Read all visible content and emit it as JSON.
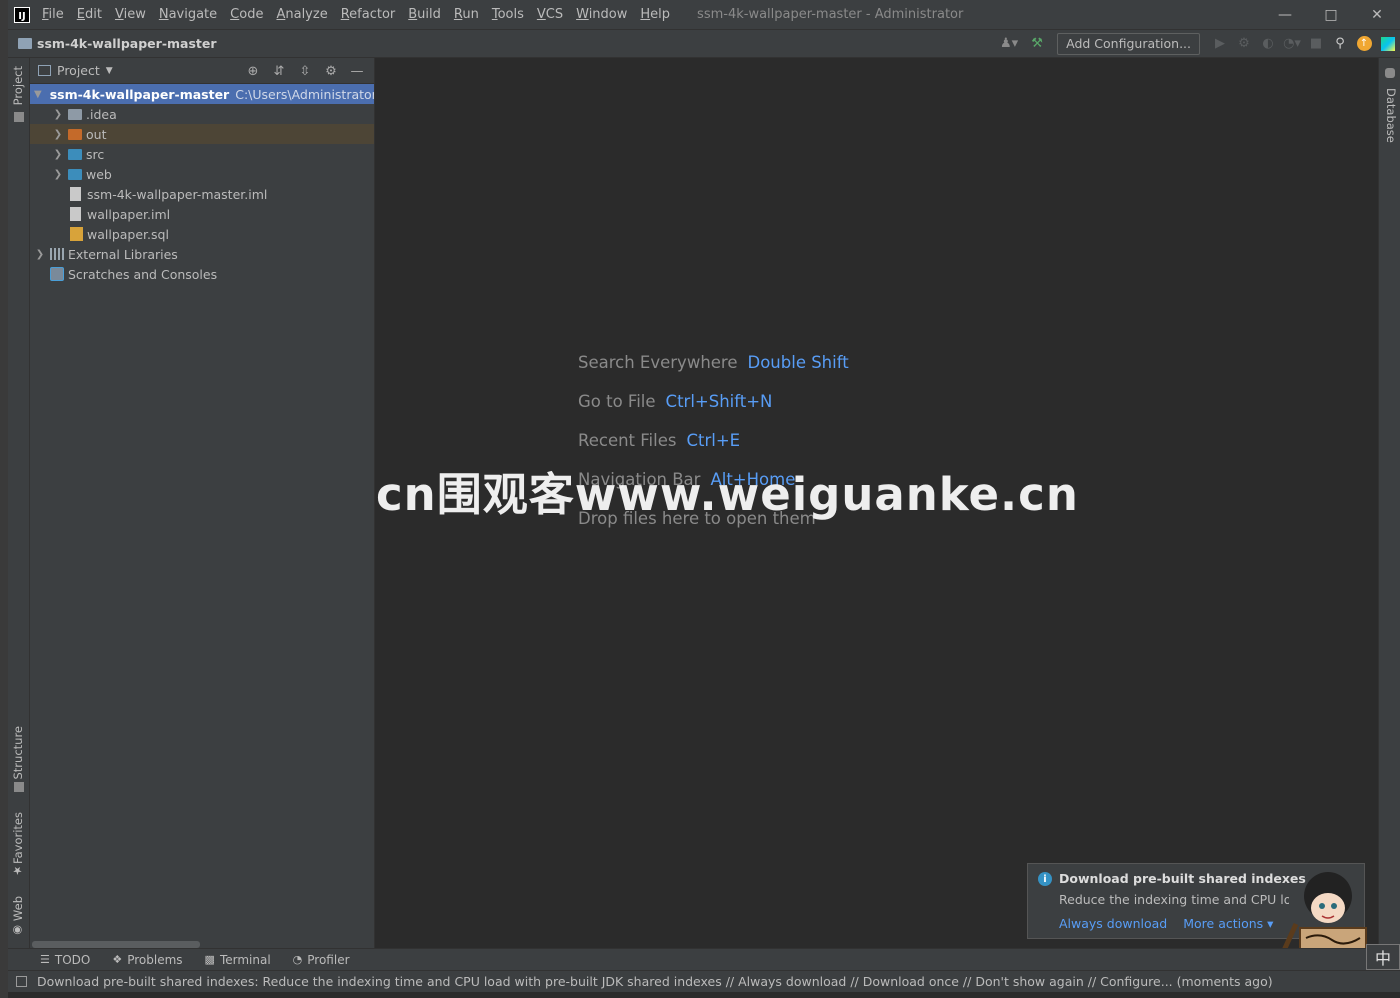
{
  "window": {
    "title": "ssm-4k-wallpaper-master - Administrator"
  },
  "menu": [
    "File",
    "Edit",
    "View",
    "Navigate",
    "Code",
    "Analyze",
    "Refactor",
    "Build",
    "Run",
    "Tools",
    "VCS",
    "Window",
    "Help"
  ],
  "navbar": {
    "breadcrumb": "ssm-4k-wallpaper-master",
    "add_config_label": "Add Configuration..."
  },
  "left_strip": {
    "project": "Project",
    "structure": "Structure",
    "favorites": "Favorites",
    "web": "Web"
  },
  "right_strip": {
    "database": "Database"
  },
  "project_panel": {
    "title": "Project",
    "tree": {
      "root": {
        "label": "ssm-4k-wallpaper-master",
        "path": "C:\\Users\\Administrator\\D"
      },
      "idea": ".idea",
      "out": "out",
      "src": "src",
      "web": "web",
      "iml1": "ssm-4k-wallpaper-master.iml",
      "iml2": "wallpaper.iml",
      "sql": "wallpaper.sql",
      "external": "External Libraries",
      "scratches": "Scratches and Consoles"
    }
  },
  "editor": {
    "hints": [
      {
        "label": "Search Everywhere",
        "key": "Double Shift"
      },
      {
        "label": "Go to File",
        "key": "Ctrl+Shift+N"
      },
      {
        "label": "Recent Files",
        "key": "Ctrl+E"
      },
      {
        "label": "Navigation Bar",
        "key": "Alt+Home"
      }
    ],
    "drop_text": "Drop files here to open them",
    "watermark": "cn围观客www.weiguanke.cn"
  },
  "notification": {
    "title": "Download pre-built shared indexes",
    "body": "Reduce the indexing time and CPU load",
    "action_primary": "Always download",
    "action_more": "More actions ▾"
  },
  "bottom_tabs": [
    "TODO",
    "Problems",
    "Terminal",
    "Profiler"
  ],
  "status": {
    "text": "Download pre-built shared indexes: Reduce the indexing time and CPU load with pre-built JDK shared indexes // Always download // Download once // Don't show again // Configure... (moments ago)"
  },
  "ime": {
    "label": "中"
  },
  "colors": {
    "selection": "#4b6eaf",
    "link": "#589df6",
    "panel_bg": "#3c3f41",
    "editor_bg": "#2b2b2b"
  }
}
